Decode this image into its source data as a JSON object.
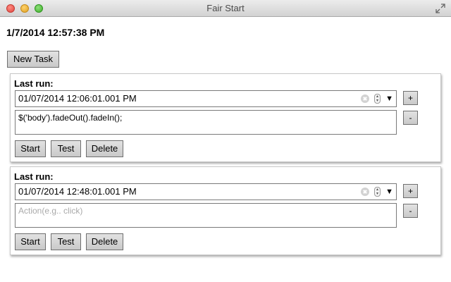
{
  "window": {
    "title": "Fair Start"
  },
  "clock": "1/7/2014 12:57:38 PM",
  "toolbar": {
    "new_task_label": "New Task"
  },
  "tasks": [
    {
      "last_run_label": "Last run:",
      "datetime": "01/07/2014  12:06:01.001  PM",
      "action_value": "$('body').fadeOut().fadeIn();",
      "action_placeholder": "",
      "plus_label": "+",
      "minus_label": "-",
      "start_label": "Start",
      "test_label": "Test",
      "delete_label": "Delete"
    },
    {
      "last_run_label": "Last run:",
      "datetime": "01/07/2014  12:48:01.001  PM",
      "action_value": "",
      "action_placeholder": "Action(e.g.. click)",
      "plus_label": "+",
      "minus_label": "-",
      "start_label": "Start",
      "test_label": "Test",
      "delete_label": "Delete"
    }
  ],
  "icons": {
    "close": "close-icon",
    "minimize": "minimize-icon",
    "zoom": "zoom-icon",
    "fullscreen": "fullscreen-icon",
    "clear": "clear-icon",
    "spin": "spin-icon",
    "dropdown": "dropdown-arrow-icon"
  }
}
